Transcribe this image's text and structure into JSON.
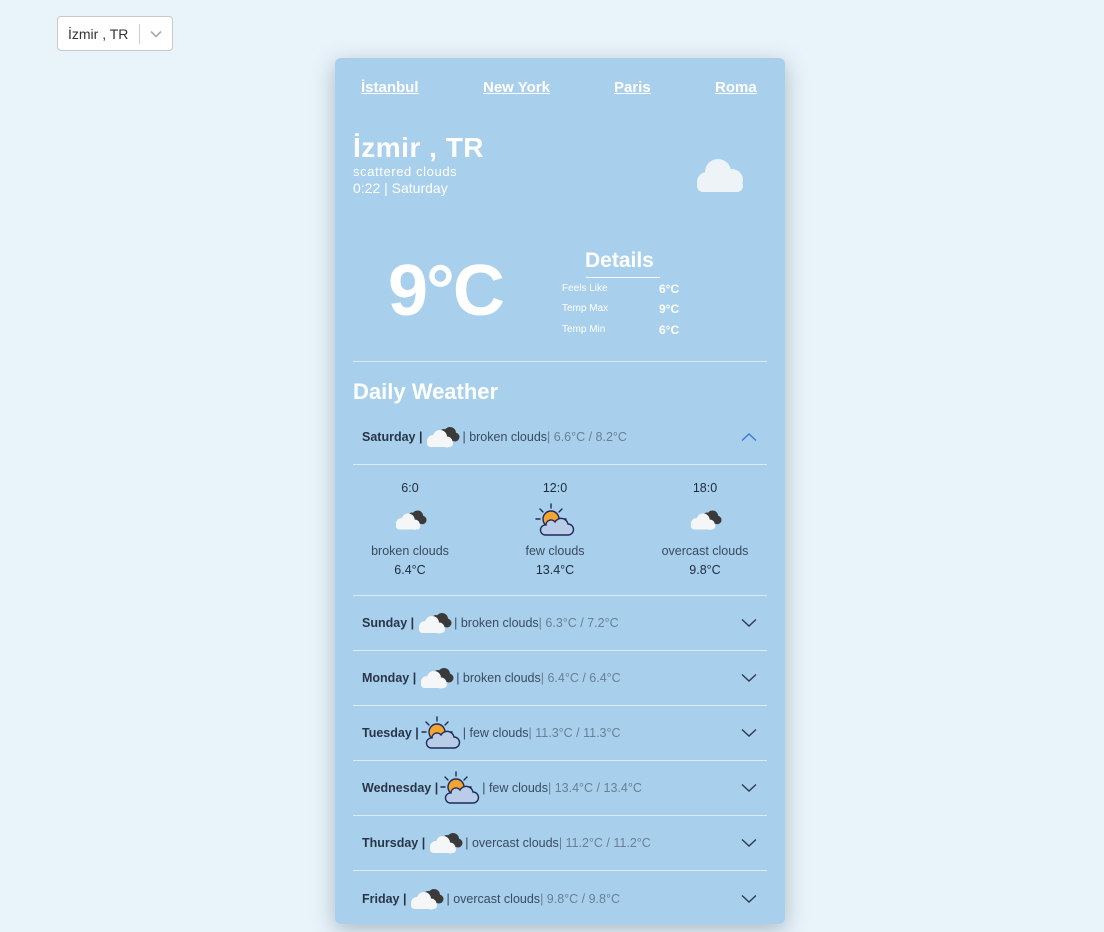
{
  "select": {
    "value": "İzmir , TR"
  },
  "nav": [
    "İstanbul",
    "New York",
    "Paris",
    "Roma"
  ],
  "current": {
    "location": "İzmir , TR",
    "description": "scattered clouds",
    "time": "0:22 | Saturday",
    "temp": "9°C",
    "icon": "cloud-icon"
  },
  "details": {
    "title": "Details",
    "rows": [
      {
        "label": "Feels Like",
        "value": "6°C"
      },
      {
        "label": "Temp Max",
        "value": "9°C"
      },
      {
        "label": "Temp Min",
        "value": "6°C"
      }
    ]
  },
  "daily": {
    "title": "Daily Weather",
    "days": [
      {
        "name": "Saturday |",
        "icon": "broken-clouds-icon",
        "desc": "| broken clouds",
        "range": "| 6.6°C / 8.2°C",
        "expanded": true
      },
      {
        "name": "Sunday |",
        "icon": "broken-clouds-icon",
        "desc": "| broken clouds",
        "range": "| 6.3°C / 7.2°C",
        "expanded": false
      },
      {
        "name": "Monday |",
        "icon": "broken-clouds-icon",
        "desc": "| broken clouds",
        "range": "| 6.4°C / 6.4°C",
        "expanded": false
      },
      {
        "name": "Tuesday |",
        "icon": "few-clouds-icon",
        "desc": "| few clouds",
        "range": "| 11.3°C / 11.3°C",
        "expanded": false
      },
      {
        "name": "Wednesday |",
        "icon": "few-clouds-icon",
        "desc": "| few clouds",
        "range": "| 13.4°C / 13.4°C",
        "expanded": false
      },
      {
        "name": "Thursday |",
        "icon": "broken-clouds-icon",
        "desc": "| overcast clouds",
        "range": "| 11.2°C / 11.2°C",
        "expanded": false
      },
      {
        "name": "Friday |",
        "icon": "broken-clouds-icon",
        "desc": "| overcast clouds",
        "range": "| 9.8°C / 9.8°C",
        "expanded": false
      }
    ],
    "hourly": [
      {
        "time": "6:0",
        "icon": "broken-clouds-icon",
        "desc": "broken clouds",
        "temp": "6.4°C"
      },
      {
        "time": "12:0",
        "icon": "few-clouds-icon",
        "desc": "few clouds",
        "temp": "13.4°C"
      },
      {
        "time": "18:0",
        "icon": "broken-clouds-icon",
        "desc": "overcast clouds",
        "temp": "9.8°C"
      }
    ]
  },
  "colors": {
    "background": "#e8f3fa",
    "card": "#a8d0ec",
    "chevron_open": "#3a7bd5"
  }
}
